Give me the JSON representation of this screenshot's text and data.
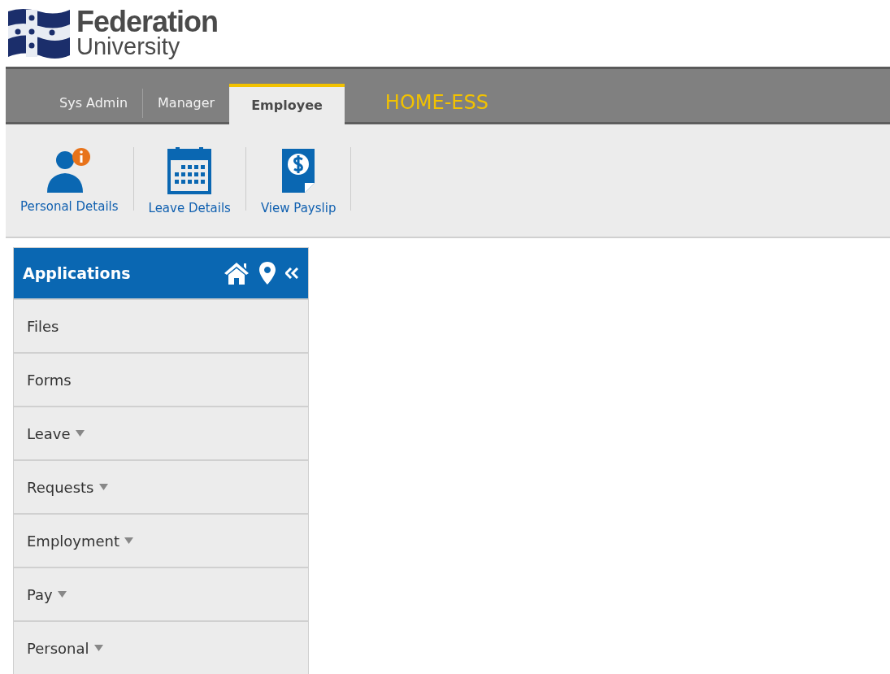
{
  "logo": {
    "line_1": "Federation",
    "line_2": "University"
  },
  "tabs": [
    {
      "label": "Sys Admin",
      "selected": false
    },
    {
      "label": "Manager",
      "selected": false
    },
    {
      "label": "Employee",
      "selected": true
    }
  ],
  "context_title": "HOME-ESS",
  "shortcuts": [
    {
      "kind": "person",
      "label": "Personal Details"
    },
    {
      "kind": "calendar",
      "label": "Leave Details"
    },
    {
      "kind": "payslip",
      "label": "View Payslip"
    }
  ],
  "sidebar": {
    "title": "Applications",
    "items": [
      {
        "label": "Files",
        "expandable": false
      },
      {
        "label": "Forms",
        "expandable": false
      },
      {
        "label": "Leave",
        "expandable": true
      },
      {
        "label": "Requests",
        "expandable": true
      },
      {
        "label": "Employment",
        "expandable": true
      },
      {
        "label": "Pay",
        "expandable": true
      },
      {
        "label": "Personal",
        "expandable": true
      }
    ]
  }
}
